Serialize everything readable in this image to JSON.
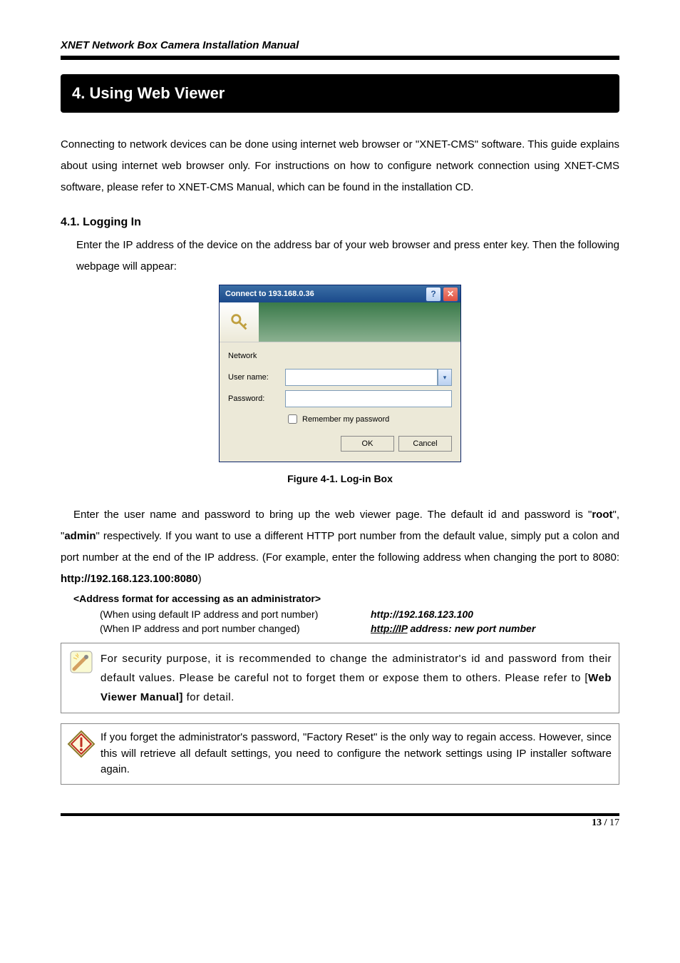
{
  "header": {
    "title": "XNET Network Box Camera Installation Manual"
  },
  "section": {
    "title": "4. Using Web Viewer"
  },
  "intro": "Connecting to network devices can be done using internet web browser or \"XNET-CMS\" software.   This guide explains about using internet web browser only. For instructions on how to configure network connection using XNET-CMS software, please refer to XNET-CMS Manual, which can be found in the installation CD.",
  "sub41": {
    "heading": "4.1. Logging In",
    "text": "Enter the IP address of the device on the address bar of your web browser and press enter key. Then the following webpage will appear:"
  },
  "dialog": {
    "title": "Connect to 193.168.0.36",
    "help_symbol": "?",
    "close_symbol": "✕",
    "network_label": "Network",
    "user_label": "User name:",
    "user_value": "",
    "pass_label": "Password:",
    "pass_value": "",
    "remember_label": "Remember my password",
    "ok_label": "OK",
    "cancel_label": "Cancel",
    "combo_arrow": "▾"
  },
  "figure_caption": "Figure 4-1. Log-in Box",
  "para2_a": "Enter the user name and password to bring up the web viewer page. The default id and password is \"",
  "para2_root": "root",
  "para2_b": "\", \"",
  "para2_admin": "admin",
  "para2_c": "\" respectively. If you want to use a different HTTP port number from the default value, simply put a colon and port number at the end of the IP address. (For example, enter the following address when changing the port to 8080: ",
  "para2_url": "http://192.168.123.100:8080",
  "para2_d": ")",
  "addr_heading": "<Address format for accessing as an administrator>",
  "addr_rows": {
    "r0": {
      "label": "(When using default IP address and port number)",
      "value_plain": "http://192.168.123.100"
    },
    "r1": {
      "label": "(When IP address and port number changed)",
      "value_http": "http://IP",
      "value_rest": " address: new port number"
    }
  },
  "note1_a": "For security purpose, it is recommended to change the administrator's id and password from their default values. Please be careful not to forget them or expose them to others. Please refer to [",
  "note1_b": "Web Viewer Manual]",
  "note1_c": " for detail.",
  "note2": "If you forget the administrator's password, \"Factory Reset\" is the only way to regain access. However, since this will retrieve all default settings, you need to configure the network settings using IP installer software again.",
  "footer": {
    "page_current": "13",
    "page_sep": " / ",
    "page_total": "17"
  }
}
